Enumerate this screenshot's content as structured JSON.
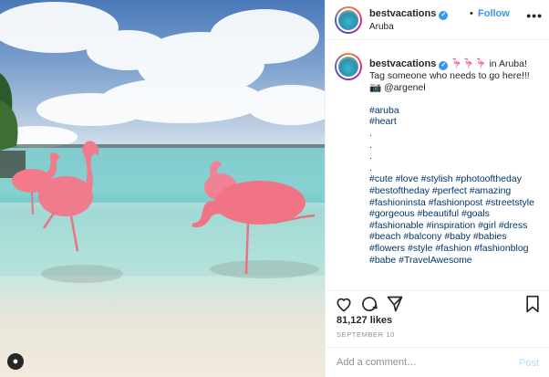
{
  "header": {
    "username": "bestvacations",
    "separator": "•",
    "follow_label": "Follow",
    "location": "Aruba"
  },
  "caption": {
    "username": "bestvacations",
    "emoji": "🦩🦩🦩",
    "text": " in Aruba! Tag someone who needs to go here!!! 📷 @argenel",
    "tags_top": [
      "#aruba",
      "#heart"
    ],
    "dots": [
      ".",
      ".",
      ".",
      "."
    ],
    "tags_body": "#cute #love #stylish #photooftheday #bestoftheday #perfect #amazing #fashioninsta #fashionpost #streetstyle #gorgeous #beautiful #goals #fashionable #inspiration #girl #dress #beach #balcony #baby #babies #flowers #style #fashion #fashionblog #babe #TravelAwesome"
  },
  "likes": "81,127 likes",
  "date": "SEPTEMBER 10",
  "comment": {
    "placeholder": "Add a comment…",
    "post_label": "Post"
  },
  "icons": {
    "verified": "verified-badge-icon",
    "like": "heart-icon",
    "comment": "comment-icon",
    "share": "share-icon",
    "save": "bookmark-icon",
    "more": "more-options-icon",
    "user_tag": "person-icon"
  },
  "colors": {
    "link": "#3897f0",
    "hashtag": "#003569",
    "muted": "#8e8e8e"
  }
}
